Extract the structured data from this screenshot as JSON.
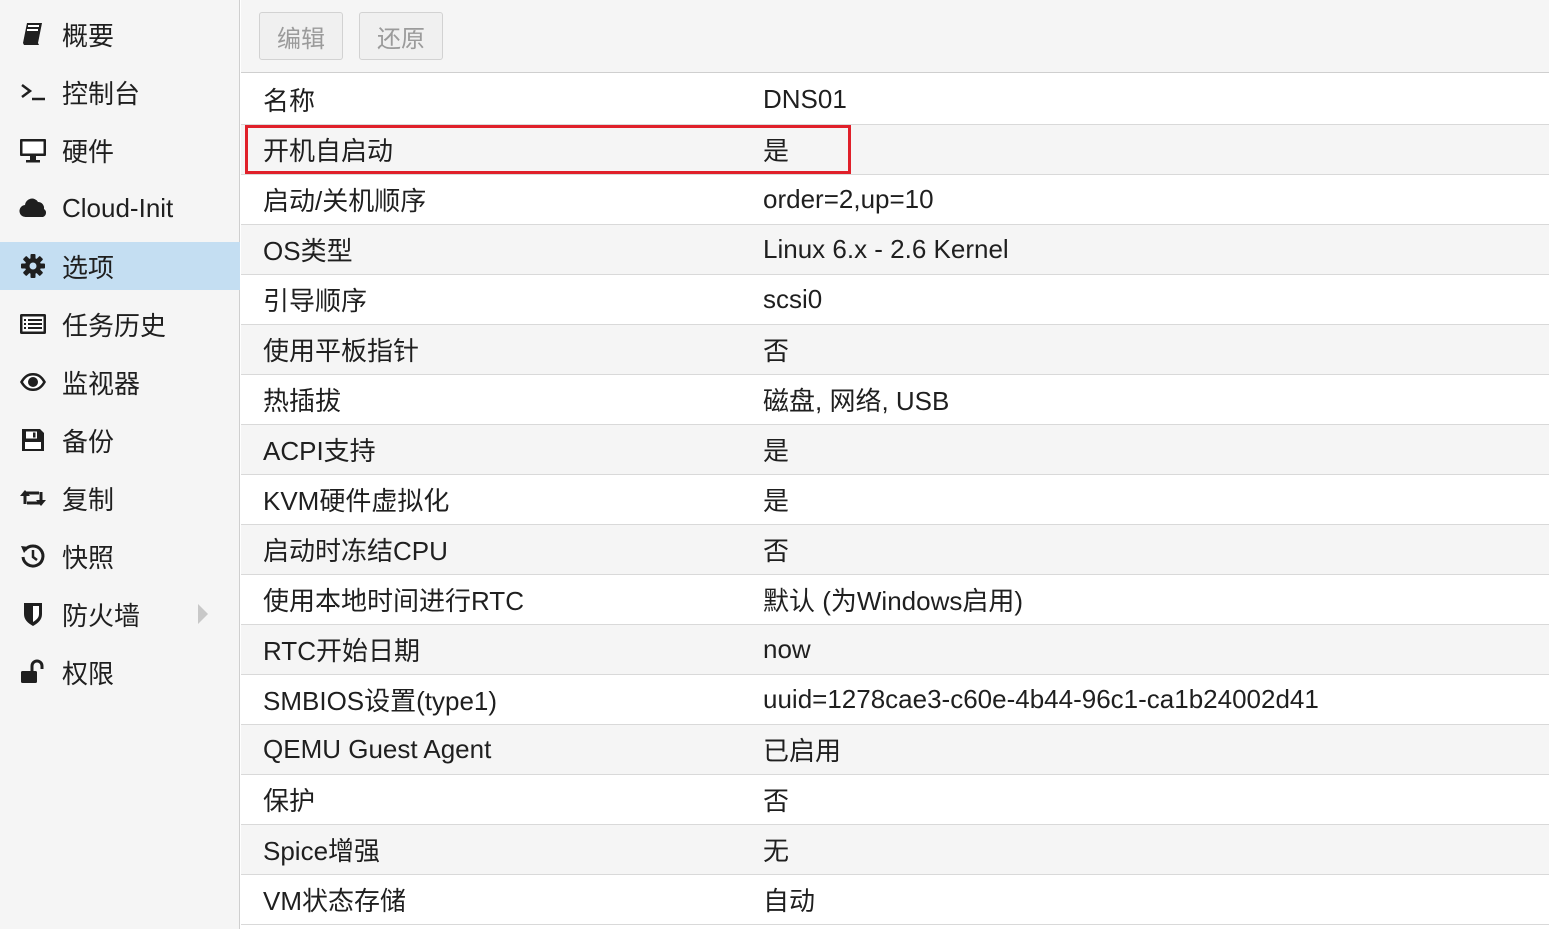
{
  "sidebar": {
    "items": [
      {
        "label": "概要",
        "icon": "book-icon"
      },
      {
        "label": "控制台",
        "icon": "terminal-icon"
      },
      {
        "label": "硬件",
        "icon": "monitor-icon"
      },
      {
        "label": "Cloud-Init",
        "icon": "cloud-icon"
      },
      {
        "label": "选项",
        "icon": "gear-icon",
        "active": true
      },
      {
        "label": "任务历史",
        "icon": "list-icon"
      },
      {
        "label": "监视器",
        "icon": "eye-icon"
      },
      {
        "label": "备份",
        "icon": "floppy-icon"
      },
      {
        "label": "复制",
        "icon": "retweet-icon"
      },
      {
        "label": "快照",
        "icon": "history-icon"
      },
      {
        "label": "防火墙",
        "icon": "shield-icon",
        "expandable": true
      },
      {
        "label": "权限",
        "icon": "unlock-icon"
      }
    ]
  },
  "toolbar": {
    "edit_label": "编辑",
    "revert_label": "还原"
  },
  "options": {
    "rows": [
      {
        "key": "名称",
        "value": "DNS01"
      },
      {
        "key": "开机自启动",
        "value": "是"
      },
      {
        "key": "启动/关机顺序",
        "value": "order=2,up=10"
      },
      {
        "key": "OS类型",
        "value": "Linux 6.x - 2.6 Kernel"
      },
      {
        "key": "引导顺序",
        "value": "scsi0"
      },
      {
        "key": "使用平板指针",
        "value": "否"
      },
      {
        "key": "热插拔",
        "value": "磁盘, 网络, USB"
      },
      {
        "key": "ACPI支持",
        "value": "是"
      },
      {
        "key": "KVM硬件虚拟化",
        "value": "是"
      },
      {
        "key": "启动时冻结CPU",
        "value": "否"
      },
      {
        "key": "使用本地时间进行RTC",
        "value": "默认 (为Windows启用)"
      },
      {
        "key": "RTC开始日期",
        "value": "now"
      },
      {
        "key": "SMBIOS设置(type1)",
        "value": "uuid=1278cae3-c60e-4b44-96c1-ca1b24002d41"
      },
      {
        "key": "QEMU Guest Agent",
        "value": "已启用"
      },
      {
        "key": "保护",
        "value": "否"
      },
      {
        "key": "Spice增强",
        "value": "无"
      },
      {
        "key": "VM状态存储",
        "value": "自动"
      }
    ]
  },
  "colors": {
    "active_nav_bg": "#c4def2",
    "highlight_border": "#e0202a"
  }
}
